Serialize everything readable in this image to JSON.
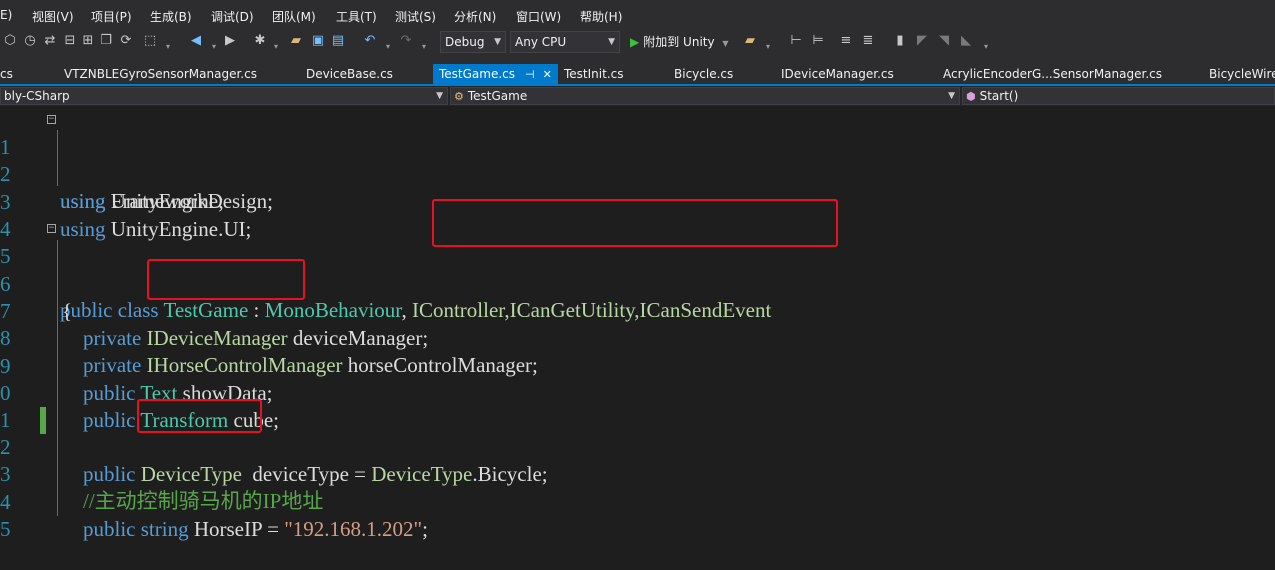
{
  "menu": [
    "E)",
    "视图(V)",
    "项目(P)",
    "生成(B)",
    "调试(D)",
    "团队(M)",
    "工具(T)",
    "测试(S)",
    "分析(N)",
    "窗口(W)",
    "帮助(H)"
  ],
  "toolbar": {
    "config": "Debug",
    "platform": "Any CPU",
    "attach_label": "附加到 Unity"
  },
  "tabs": [
    "cs",
    "VTZNBLEGyroSensorManager.cs",
    "DeviceBase.cs",
    "TestGame.cs",
    "TestInit.cs",
    "Bicycle.cs",
    "IDeviceManager.cs",
    "AcrylicEncoderG...SensorManager.cs",
    "BicycleWire"
  ],
  "active_tab": "TestGame.cs",
  "navbar": {
    "project": "bly-CSharp",
    "class": "TestGame",
    "member": "Start()"
  },
  "code": {
    "ln1": "1",
    "ln2": "2",
    "ln3": "3",
    "ln4": "4",
    "ln5": "5",
    "ln6": "6",
    "ln7": "7",
    "ln8": "8",
    "ln9": "9",
    "ln10": "0",
    "ln11": "1",
    "ln12": "2",
    "ln13": "3",
    "ln14": "4",
    "ln15": "5",
    "using": "using",
    "unityengine": "UnityEngine;",
    "frameworkdesign": "FrameworkDesign;",
    "unityengine_ui": "UnityEngine.UI;",
    "public": "public",
    "class": "class",
    "testgame": "TestGame",
    "colon": " : ",
    "monobehaviour": "MonoBehaviour",
    "comma": ",",
    "interfaces": "IController,ICanGetUtility,ICanSendEvent",
    "brace": "{",
    "private": "private",
    "idevicemanager": "IDeviceManager",
    "devicemanager_var": "deviceManager;",
    "ihorsecontrolmanager": "IHorseControlManager",
    "horsecontrolmanager_var": "horseControlManager;",
    "text_type": "Text",
    "showdata_var": "showData;",
    "transform_type": "Transform",
    "cube_var": "cube;",
    "devicetype": "DeviceType",
    "devicetype_assign": "deviceType = ",
    "devicetype_enum": "DeviceType",
    "bicycle": ".Bicycle;",
    "comment": "//主动控制骑马机的IP地址",
    "string_kw": "string",
    "horseip": "HorseIP = ",
    "ip_value": "\"192.168.1.202\"",
    "semicolon": ";"
  },
  "colors": {
    "keyword": "#569cd6",
    "type": "#4ec9b0",
    "comment": "#57a64a",
    "string": "#d69d85",
    "highlight_box": "#e81123",
    "accent": "#007acc"
  }
}
